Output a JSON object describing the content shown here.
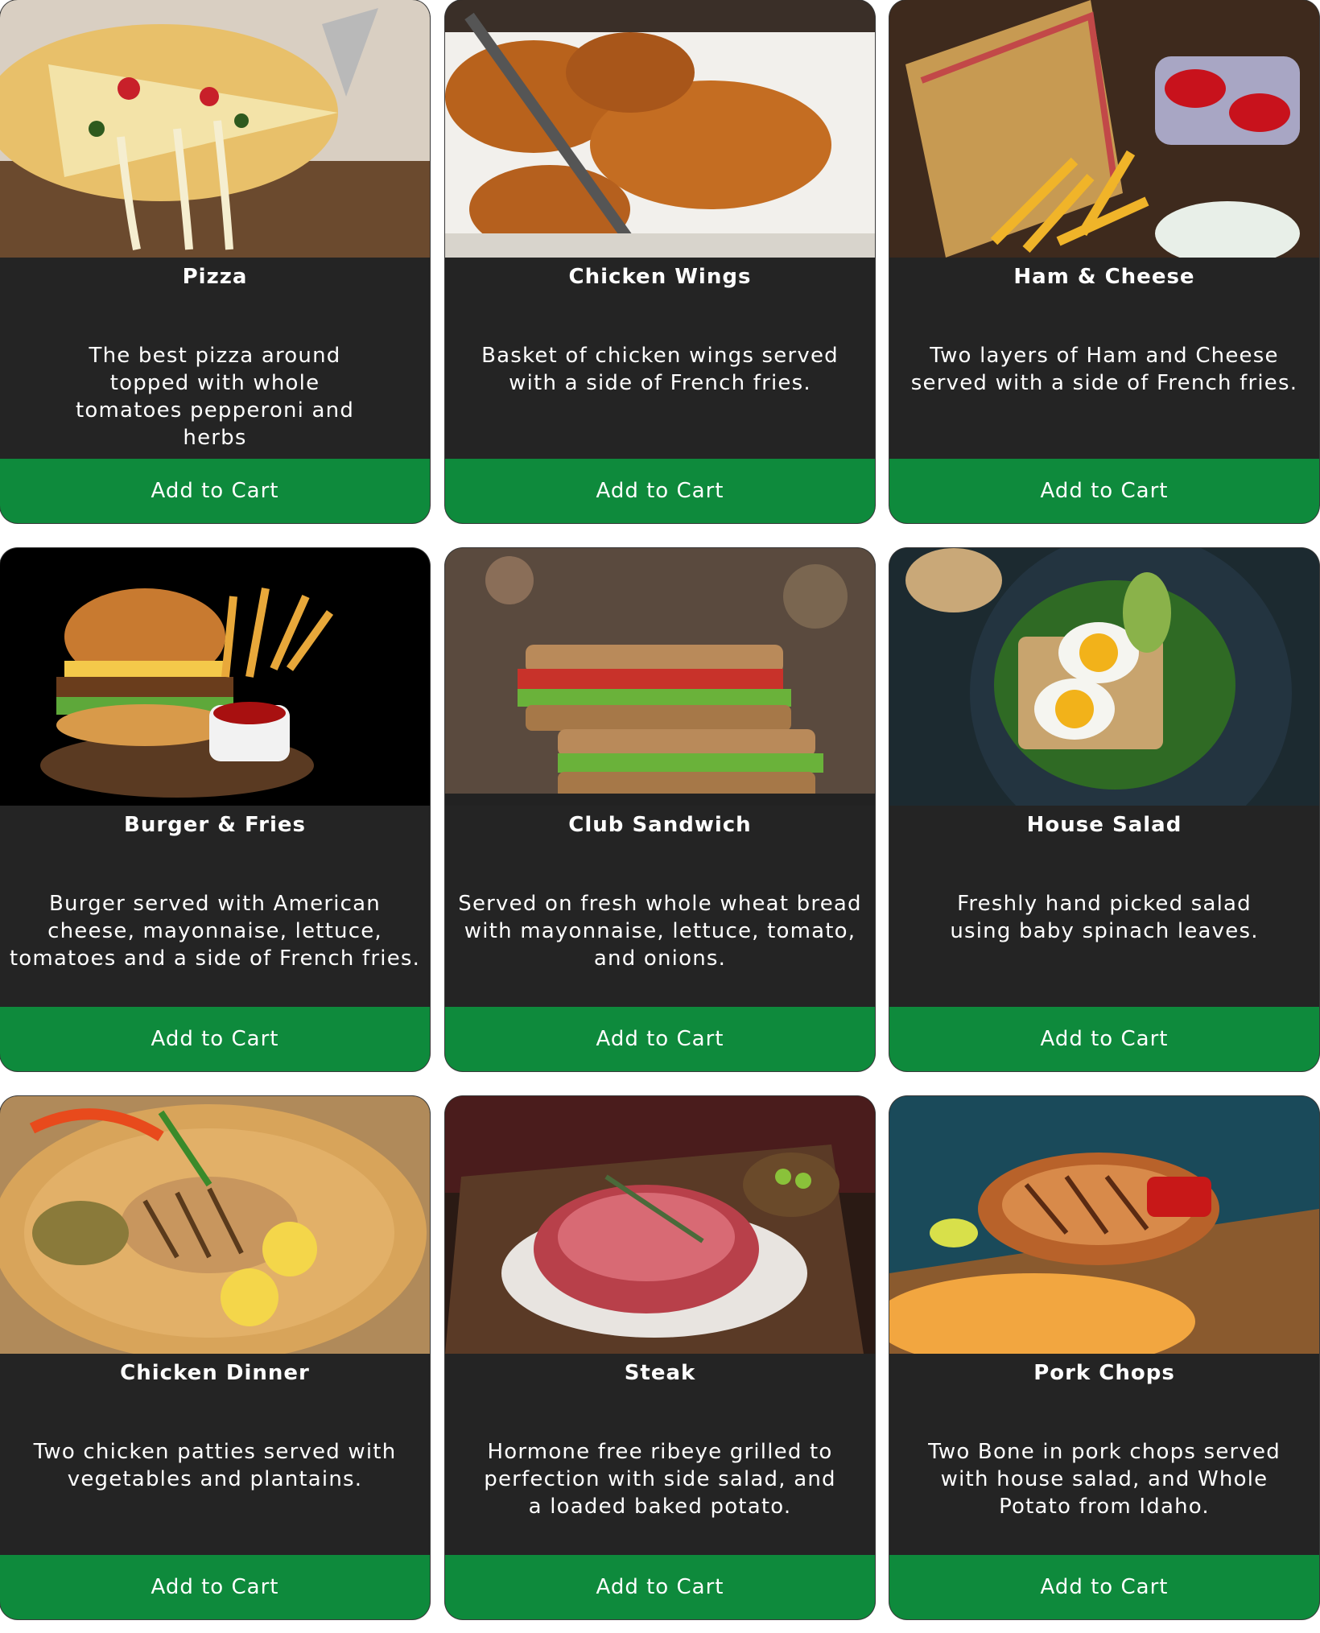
{
  "items": [
    {
      "title": "Pizza",
      "description": "The best pizza around topped with whole tomatoes pepperoni and herbs",
      "button_label": "Add to Cart",
      "image": "pizza-photo"
    },
    {
      "title": "Chicken Wings",
      "description": "Basket of chicken wings served with a side of French fries.",
      "button_label": "Add to Cart",
      "image": "chicken-wings-photo"
    },
    {
      "title": "Ham & Cheese",
      "description": "Two layers of Ham and Cheese served with a side of French fries.",
      "button_label": "Add to Cart",
      "image": "ham-cheese-photo"
    },
    {
      "title": "Burger & Fries",
      "description": "Burger served with American cheese, mayonnaise, lettuce, tomatoes and a side of French fries.",
      "button_label": "Add to Cart",
      "image": "burger-fries-photo"
    },
    {
      "title": "Club Sandwich",
      "description": "Served on fresh whole wheat bread with mayonnaise, lettuce, tomato, and onions.",
      "button_label": "Add to Cart",
      "image": "club-sandwich-photo"
    },
    {
      "title": "House Salad",
      "description": "Freshly hand picked salad using baby spinach leaves.",
      "button_label": "Add to Cart",
      "image": "house-salad-photo"
    },
    {
      "title": "Chicken Dinner",
      "description": "Two chicken patties served with vegetables and plantains.",
      "button_label": "Add to Cart",
      "image": "chicken-dinner-photo"
    },
    {
      "title": "Steak",
      "description": "Hormone free ribeye grilled to perfection with side salad, and a loaded baked potato.",
      "button_label": "Add to Cart",
      "image": "steak-photo"
    },
    {
      "title": "Pork Chops",
      "description": "Two Bone in pork chops served with house salad, and Whole Potato from Idaho.",
      "button_label": "Add to Cart",
      "image": "pork-chops-photo"
    }
  ],
  "colors": {
    "card_background": "#242424",
    "button_green": "#0e8a3c",
    "text": "#ffffff"
  }
}
